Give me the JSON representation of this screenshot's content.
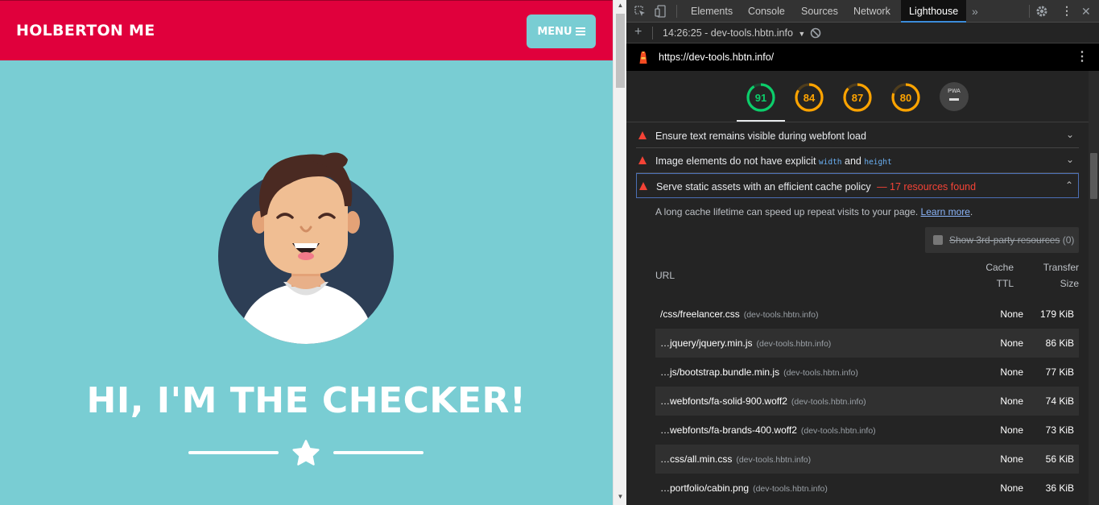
{
  "site": {
    "brand": "HOLBERTON ME",
    "menu_label": "MENU",
    "hero_title": "HI, I'M THE CHECKER!",
    "colors": {
      "nav": "#E0003C",
      "hero": "#79CDD3"
    }
  },
  "devtools": {
    "tabs": [
      {
        "label": "Elements"
      },
      {
        "label": "Console"
      },
      {
        "label": "Sources"
      },
      {
        "label": "Network"
      },
      {
        "label": "Lighthouse",
        "active": true
      }
    ],
    "report_selector": "14:26:25 - dev-tools.hbtn.info",
    "url": "https://dev-tools.hbtn.info/",
    "scores": [
      {
        "value": "91",
        "color": "#0cce6b",
        "fraction": 0.91
      },
      {
        "value": "84",
        "color": "#ffa400",
        "fraction": 0.84
      },
      {
        "value": "87",
        "color": "#ffa400",
        "fraction": 0.87
      },
      {
        "value": "80",
        "color": "#ffa400",
        "fraction": 0.8
      }
    ],
    "pwa_label": "PWA",
    "audits": [
      {
        "title": "Ensure text remains visible during webfont load"
      },
      {
        "title_pre": "Image elements do not have explicit",
        "code1": "width",
        "and": "and",
        "code2": "height"
      },
      {
        "title": "Serve static assets with an efficient cache policy",
        "summary": "— 17 resources found"
      }
    ],
    "description": "A long cache lifetime can speed up repeat visits to your page.",
    "learn_more": "Learn more",
    "third_party": {
      "label": "Show 3rd-party resources",
      "count": "(0)"
    },
    "table": {
      "col_url": "URL",
      "col_cache_1": "Cache",
      "col_cache_2": "TTL",
      "col_size_1": "Transfer",
      "col_size_2": "Size",
      "rows": [
        {
          "url": "/css/freelancer.css",
          "host": "(dev-tools.hbtn.info)",
          "ttl": "None",
          "size": "179 KiB"
        },
        {
          "url": "…jquery/jquery.min.js",
          "host": "(dev-tools.hbtn.info)",
          "ttl": "None",
          "size": "86 KiB"
        },
        {
          "url": "…js/bootstrap.bundle.min.js",
          "host": "(dev-tools.hbtn.info)",
          "ttl": "None",
          "size": "77 KiB"
        },
        {
          "url": "…webfonts/fa-solid-900.woff2",
          "host": "(dev-tools.hbtn.info)",
          "ttl": "None",
          "size": "74 KiB"
        },
        {
          "url": "…webfonts/fa-brands-400.woff2",
          "host": "(dev-tools.hbtn.info)",
          "ttl": "None",
          "size": "73 KiB"
        },
        {
          "url": "…css/all.min.css",
          "host": "(dev-tools.hbtn.info)",
          "ttl": "None",
          "size": "56 KiB"
        },
        {
          "url": "…portfolio/cabin.png",
          "host": "(dev-tools.hbtn.info)",
          "ttl": "None",
          "size": "36 KiB"
        }
      ]
    }
  }
}
